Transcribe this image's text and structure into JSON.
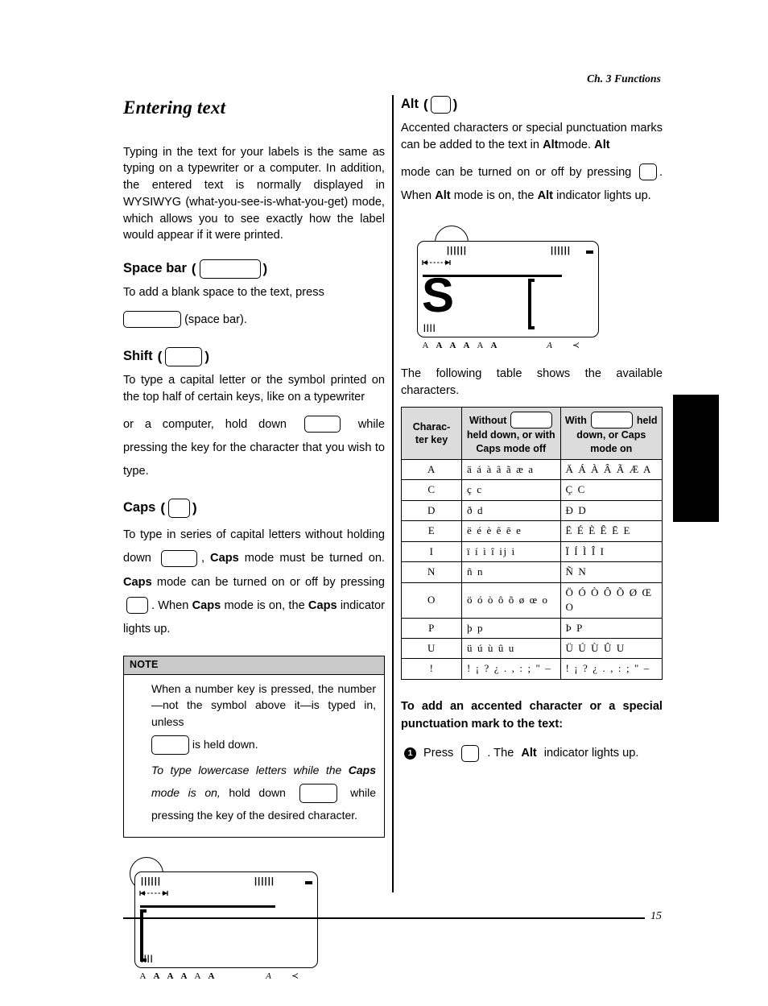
{
  "running_head": "Ch. 3 Functions",
  "folio": "15",
  "left_column": {
    "section_title": "Entering text",
    "intro": "Typing in the text for your labels is the same as typing on a typewriter or a computer. In addition, the entered text is normally displayed in WYSIWYG (what-you-see-is-what-you-get) mode, which allows you to see exactly how the label would appear if it were printed.",
    "space_bar": {
      "heading": "Space bar",
      "paren_open": "(",
      "paren_close": ")",
      "text_1": "To add a blank space to the text, press",
      "text_2": "(space bar)."
    },
    "shift": {
      "heading": "Shift",
      "paren_open": "(",
      "paren_close": ")",
      "text_1": "To type a capital letter or the symbol printed on the top half of certain keys, like on a typewriter",
      "text_2": "or a computer, hold down",
      "text_3": "while pressing the key for the character that you wish to type."
    },
    "caps": {
      "heading": "Caps",
      "paren_open": "(",
      "paren_close": ")",
      "text_1": "To type in series of capital letters without holding down",
      "text_2": ",",
      "text_3_bold": "Caps",
      "text_4": "mode must be turned on.",
      "text_5_bold": "Caps",
      "text_6": "mode can be turned on or off by pressing",
      "text_7": ". When",
      "text_8_bold": "Caps",
      "text_9": "mode is on, the",
      "text_10_bold": "Caps",
      "text_11": "indicator lights up."
    },
    "note": {
      "label": "NOTE",
      "para_1_a": "When a number key is pressed, the number—not the symbol above it—is typed in, unless",
      "para_1_b": "is held down.",
      "para_2_a": "To type lowercase letters while the",
      "para_2_bold": "Caps",
      "para_2_b": "mode is on,",
      "para_2_c": "hold down",
      "para_2_d": "while pressing the key of the desired character."
    },
    "lcd": {
      "indicators": [
        "A",
        "A",
        "A",
        "A",
        "A",
        "A",
        "A",
        "≺"
      ],
      "display_text": ""
    }
  },
  "right_column": {
    "alt": {
      "heading": "Alt",
      "paren_open": "(",
      "paren_close": ")",
      "text_1": "Accented characters or special punctuation marks can be added to the text in",
      "text_1_bold": "Alt",
      "text_2": "mode.",
      "text_2_bold": "Alt",
      "text_3": "mode can be turned on or off by pressing",
      "text_4": ". When",
      "text_4_bold": "Alt",
      "text_5": "mode is on, the",
      "text_5_bold": "Alt",
      "text_6": "indicator lights up."
    },
    "lcd": {
      "indicators": [
        "A",
        "A",
        "A",
        "A",
        "A",
        "A",
        "A",
        "≺"
      ],
      "display_text": "S"
    },
    "table_intro": "The following table shows the available characters.",
    "table": {
      "headers": {
        "col1": "Charac-\nter key",
        "col2_pre": "Without",
        "col2_post": "held down, or with Caps mode off",
        "col3_pre": "With",
        "col3_mid": "held",
        "col3_post": "down, or Caps mode on"
      },
      "rows": [
        {
          "key": "A",
          "lower": "ä á à â ã æ a",
          "upper": "Ä Á À Â Ã Æ A"
        },
        {
          "key": "C",
          "lower": "ç c",
          "upper": "Ç C"
        },
        {
          "key": "D",
          "lower": "ð d",
          "upper": "Ð D"
        },
        {
          "key": "E",
          "lower": "ë é è ê ē e",
          "upper": "Ë É È Ê Ē E"
        },
        {
          "key": "I",
          "lower": "ï í ì î ij i",
          "upper": "Ï Í Ì Î I"
        },
        {
          "key": "N",
          "lower": "ñ n",
          "upper": "Ñ N"
        },
        {
          "key": "O",
          "lower": "ö ó ò ô õ ø œ o",
          "upper": "Ö Ó Ò Ô Õ Ø Œ O"
        },
        {
          "key": "P",
          "lower": "þ p",
          "upper": "Þ P"
        },
        {
          "key": "U",
          "lower": "ü ú ù û u",
          "upper": "Ü Ú Ù Û U"
        },
        {
          "key": "!",
          "lower": "! ¡ ? ¿ . , : ; \" –",
          "upper": "! ¡ ? ¿ . , : ; \" –"
        }
      ]
    },
    "procedure": {
      "heading": "To add an accented character or a special punctuation mark to the text:",
      "step_1_num": "1",
      "step_1_a": "Press",
      "step_1_b": ". The",
      "step_1_bold": "Alt",
      "step_1_c": "indicator lights up."
    }
  },
  "colors": {
    "ink": "#000000",
    "note_header_bg": "#c9c9c9",
    "table_header_bg": "#dcdcdc",
    "paper": "#ffffff"
  }
}
